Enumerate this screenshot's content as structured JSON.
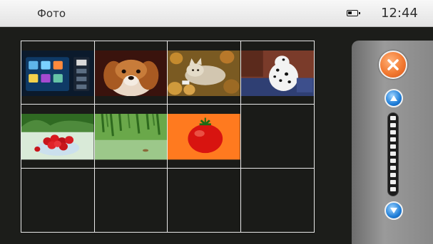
{
  "status_bar": {
    "title": "Фото",
    "time": "12:44",
    "battery_icon": "battery-icon"
  },
  "gallery": {
    "rows": 3,
    "columns": 4,
    "thumbnails": [
      {
        "name": "photo-app-menu",
        "filled": true
      },
      {
        "name": "photo-dog",
        "filled": true
      },
      {
        "name": "photo-cat",
        "filled": true
      },
      {
        "name": "photo-dalmatian",
        "filled": true
      },
      {
        "name": "photo-cherries",
        "filled": true
      },
      {
        "name": "photo-willow-pond",
        "filled": true
      },
      {
        "name": "photo-tomato",
        "filled": true
      },
      {
        "name": "empty",
        "filled": false
      },
      {
        "name": "empty",
        "filled": false
      },
      {
        "name": "empty",
        "filled": false
      },
      {
        "name": "empty",
        "filled": false
      },
      {
        "name": "empty",
        "filled": false
      }
    ]
  },
  "side_panel": {
    "close_icon": "close-icon",
    "up_icon": "arrow-up-icon",
    "down_icon": "arrow-down-icon",
    "scroll_ticks": 11
  },
  "colors": {
    "accent_close": "#f27a32",
    "accent_scroll": "#1f7ed8",
    "grid_line": "#e8e8e8"
  }
}
